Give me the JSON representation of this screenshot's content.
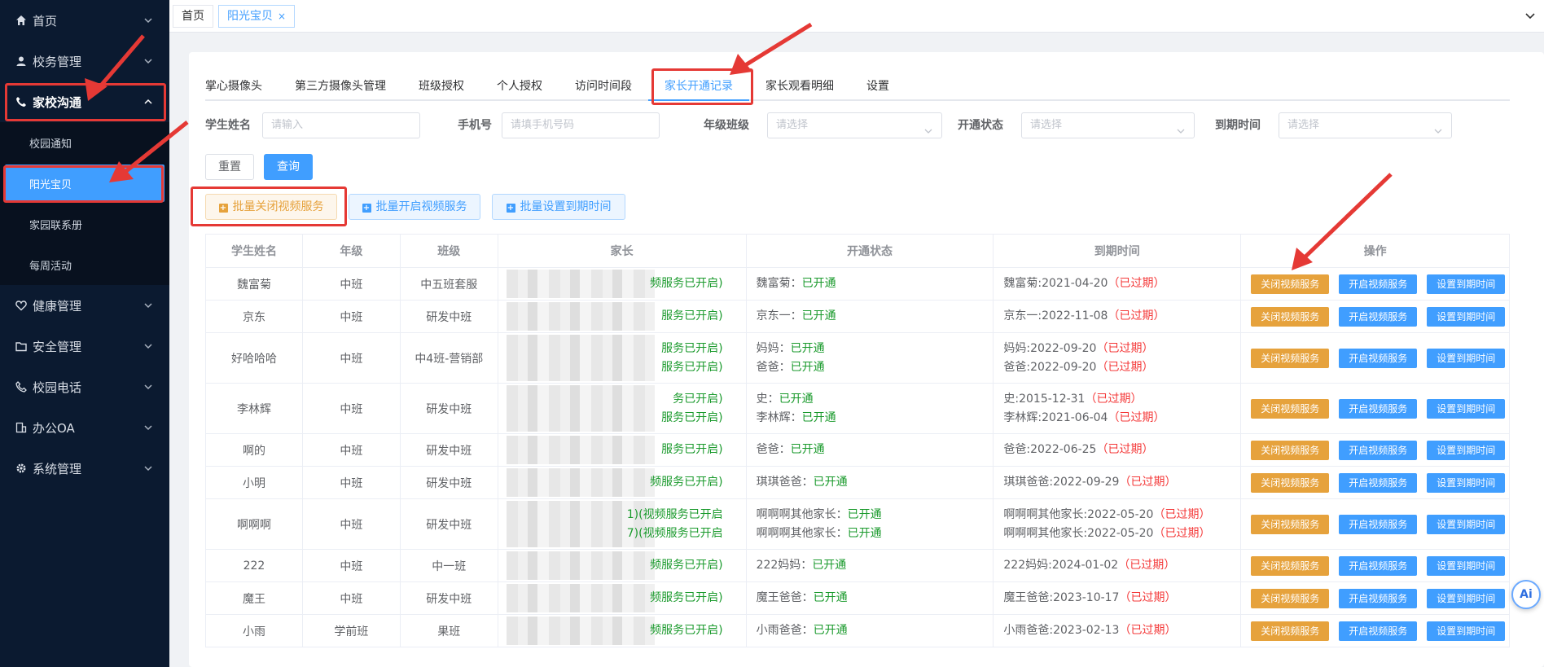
{
  "sidebar": {
    "items": [
      {
        "label": "首页",
        "icon": "home-icon"
      },
      {
        "label": "校务管理",
        "icon": "user-icon"
      },
      {
        "label": "家校沟通",
        "icon": "phone-icon"
      },
      {
        "label": "健康管理",
        "icon": "heart-icon"
      },
      {
        "label": "安全管理",
        "icon": "folder-icon"
      },
      {
        "label": "校园电话",
        "icon": "call-icon"
      },
      {
        "label": "办公OA",
        "icon": "building-icon"
      },
      {
        "label": "系统管理",
        "icon": "gear-icon"
      }
    ],
    "submenu": [
      {
        "label": "校园通知"
      },
      {
        "label": "阳光宝贝"
      },
      {
        "label": "家园联系册"
      },
      {
        "label": "每周活动"
      }
    ]
  },
  "topbar": {
    "tabs": [
      {
        "label": "首页"
      },
      {
        "label": "阳光宝贝",
        "close": "×"
      }
    ]
  },
  "tabs": [
    "掌心摄像头",
    "第三方摄像头管理",
    "班级授权",
    "个人授权",
    "访问时间段",
    "家长开通记录",
    "家长观看明细",
    "设置"
  ],
  "filters": {
    "student_name": {
      "label": "学生姓名",
      "placeholder": "请输入"
    },
    "phone": {
      "label": "手机号",
      "placeholder": "请填手机号码"
    },
    "grade_class": {
      "label": "年级班级",
      "placeholder": "请选择"
    },
    "status": {
      "label": "开通状态",
      "placeholder": "请选择"
    },
    "expire": {
      "label": "到期时间",
      "placeholder": "请选择"
    }
  },
  "buttons": {
    "reset": "重置",
    "query": "查询",
    "batch_close": "批量关闭视频服务",
    "batch_open": "批量开启视频服务",
    "batch_expire": "批量设置到期时间",
    "row_close": "关闭视频服务",
    "row_open": "开启视频服务",
    "row_set": "设置到期时间"
  },
  "table": {
    "headers": [
      "学生姓名",
      "年级",
      "班级",
      "家长",
      "开通状态",
      "到期时间",
      "操作"
    ],
    "rows": [
      {
        "name": "魏富菊",
        "grade": "中班",
        "cls": "中五班套服",
        "parent": [
          "频服务已开启)"
        ],
        "status": [
          [
            "魏富菊：",
            "已开通"
          ]
        ],
        "expire": [
          [
            "魏富菊:2021-04-20",
            "（已过期）"
          ]
        ]
      },
      {
        "name": "京东",
        "grade": "中班",
        "cls": "研发中班",
        "parent": [
          "服务已开启)"
        ],
        "status": [
          [
            "京东一：",
            "已开通"
          ]
        ],
        "expire": [
          [
            "京东一:2022-11-08",
            "（已过期）"
          ]
        ]
      },
      {
        "name": "好哈哈哈",
        "grade": "中班",
        "cls": "中4班-营销部",
        "parent": [
          "服务已开启)",
          "服务已开启)"
        ],
        "status": [
          [
            "妈妈：",
            "已开通"
          ],
          [
            "爸爸：",
            "已开通"
          ]
        ],
        "expire": [
          [
            "妈妈:2022-09-20",
            "（已过期）"
          ],
          [
            "爸爸:2022-09-20",
            "（已过期）"
          ]
        ]
      },
      {
        "name": "李林辉",
        "grade": "中班",
        "cls": "研发中班",
        "parent": [
          "务已开启)",
          "服务已开启)"
        ],
        "status": [
          [
            "史：",
            "已开通"
          ],
          [
            "李林辉：",
            "已开通"
          ]
        ],
        "expire": [
          [
            "史:2015-12-31",
            "（已过期）"
          ],
          [
            "李林辉:2021-06-04",
            "（已过期）"
          ]
        ]
      },
      {
        "name": "啊的",
        "grade": "中班",
        "cls": "研发中班",
        "parent": [
          "服务已开启)"
        ],
        "status": [
          [
            "爸爸：",
            "已开通"
          ]
        ],
        "expire": [
          [
            "爸爸:2022-06-25",
            "（已过期）"
          ]
        ]
      },
      {
        "name": "小明",
        "grade": "中班",
        "cls": "研发中班",
        "parent": [
          "频服务已开启)"
        ],
        "status": [
          [
            "琪琪爸爸：",
            "已开通"
          ]
        ],
        "expire": [
          [
            "琪琪爸爸:2022-09-29",
            "（已过期）"
          ]
        ]
      },
      {
        "name": "啊啊啊",
        "grade": "中班",
        "cls": "研发中班",
        "parent": [
          "1)(视频服务已开启",
          "7)(视频服务已开启"
        ],
        "status": [
          [
            "啊啊啊其他家长：",
            "已开通"
          ],
          [
            "啊啊啊其他家长：",
            "已开通"
          ]
        ],
        "expire": [
          [
            "啊啊啊其他家长:2022-05-20",
            "（已过期）"
          ],
          [
            "啊啊啊其他家长:2022-05-20",
            "（已过期）"
          ]
        ]
      },
      {
        "name": "222",
        "grade": "中班",
        "cls": "中一班",
        "parent": [
          "频服务已开启)"
        ],
        "status": [
          [
            "222妈妈：",
            "已开通"
          ]
        ],
        "expire": [
          [
            "222妈妈:2024-01-02",
            "（已过期）"
          ]
        ]
      },
      {
        "name": "魔王",
        "grade": "中班",
        "cls": "研发中班",
        "parent": [
          "频服务已开启)"
        ],
        "status": [
          [
            "魔王爸爸：",
            "已开通"
          ]
        ],
        "expire": [
          [
            "魔王爸爸:2023-10-17",
            "（已过期）"
          ]
        ]
      },
      {
        "name": "小雨",
        "grade": "学前班",
        "cls": "果班",
        "parent": [
          "频服务已开启)"
        ],
        "status": [
          [
            "小雨爸爸：",
            "已开通"
          ]
        ],
        "expire": [
          [
            "小雨爸爸:2023-02-13",
            "（已过期）"
          ]
        ]
      }
    ]
  },
  "floating": {
    "ai_label": "Ai"
  },
  "colors": {
    "sidebar_bg": "#0b1a30",
    "primary": "#409eff",
    "warning": "#e6a23c",
    "success": "#1a9a2c",
    "danger": "#f43838",
    "annotation": "#e53935"
  }
}
